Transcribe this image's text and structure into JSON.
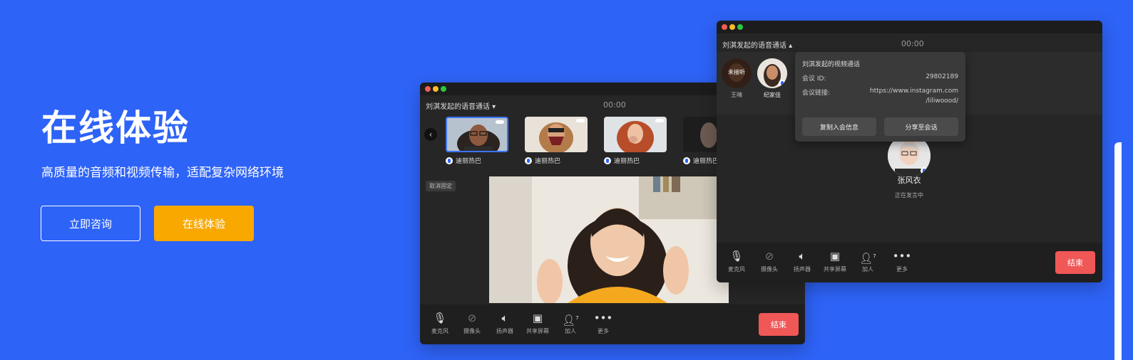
{
  "hero": {
    "title": "在线体验",
    "subtitle": "高质量的音频和视频传输，适配复杂网络环境",
    "consult_label": "立即咨询",
    "try_label": "在线体验"
  },
  "colors": {
    "background": "#2e63f7",
    "cta": "#f9a800",
    "end": "#f05757",
    "window": "#262626"
  },
  "back_window": {
    "title": "刘淇发起的语音通话",
    "timer": "00:00",
    "participants": [
      {
        "name": "迪丽热巴",
        "selected": true
      },
      {
        "name": "迪丽热巴",
        "selected": false
      },
      {
        "name": "迪丽热巴",
        "selected": false
      },
      {
        "name": "迪丽热巴",
        "selected": false
      }
    ],
    "unpin_label": "取消固定",
    "toolbar": {
      "mic": "麦克风",
      "camera": "摄像头",
      "speaker": "扬声器",
      "share": "共享屏幕",
      "add": "加人",
      "add_count": "7",
      "more": "更多",
      "end": "结束"
    }
  },
  "front_window": {
    "title": "刘淇发起的语音通话",
    "timer": "00:00",
    "members": [
      {
        "name": "王晴",
        "badge": "未接听"
      },
      {
        "name": "纪家佳",
        "badge": ""
      }
    ],
    "popup": {
      "title": "刘淇发起的视频通话",
      "id_label": "会议 ID:",
      "id_value": "29802189",
      "link_label": "会议链接:",
      "link_value_1": "https://www.instagram.com",
      "link_value_2": "/liliwoood/",
      "copy_label": "复制入会信息",
      "share_label": "分享至会话"
    },
    "speaker": {
      "name": "张风衣",
      "status": "正在发言中"
    },
    "toolbar": {
      "mic": "麦克风",
      "camera": "摄像头",
      "speaker": "扬声器",
      "share": "共享屏幕",
      "add": "加人",
      "add_count": "7",
      "more": "更多",
      "end": "结束"
    }
  }
}
